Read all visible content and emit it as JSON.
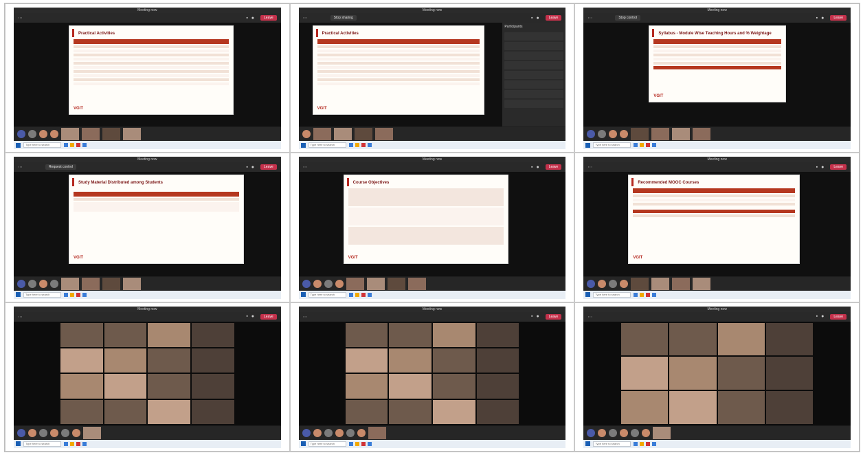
{
  "screens": [
    {
      "window_title": "Meeting now",
      "share_label": "",
      "slide_title": "Practical Activities",
      "leave_label": "Leave",
      "search_placeholder": "Type here to search"
    },
    {
      "window_title": "Meeting now",
      "share_label": "Stop sharing",
      "slide_title": "Practical Activities",
      "leave_label": "Leave",
      "search_placeholder": "Type here to search",
      "panel_title": "Participants"
    },
    {
      "window_title": "Meeting now",
      "share_label": "Stop control",
      "slide_title": "Syllabus - Module Wise Teaching Hours and % Weightage",
      "leave_label": "Leave",
      "search_placeholder": "Type here to search"
    },
    {
      "window_title": "Meeting now",
      "share_label": "Request control",
      "slide_title": "Study Material Distributed among Students",
      "leave_label": "Leave",
      "search_placeholder": "Type here to search"
    },
    {
      "window_title": "Meeting now",
      "share_label": "",
      "slide_title": "Course Objectives",
      "leave_label": "Leave",
      "search_placeholder": "Type here to search"
    },
    {
      "window_title": "Meeting now",
      "share_label": "",
      "slide_title": "Recommended MOOC Courses",
      "leave_label": "Leave",
      "search_placeholder": "Type here to search"
    },
    {
      "window_title": "Meeting now",
      "share_label": "",
      "slide_title": "",
      "leave_label": "Leave",
      "search_placeholder": "Type here to search"
    },
    {
      "window_title": "Meeting now",
      "share_label": "",
      "slide_title": "",
      "leave_label": "Leave",
      "search_placeholder": "Type here to search"
    },
    {
      "window_title": "Meeting now",
      "share_label": "",
      "slide_title": "",
      "leave_label": "Leave",
      "search_placeholder": "Type here to search"
    }
  ],
  "logo_text": "VGIT",
  "colors": {
    "slide_accent": "#b5281f",
    "leave": "#c4314b",
    "teams_bg": "#1f1f1f"
  }
}
